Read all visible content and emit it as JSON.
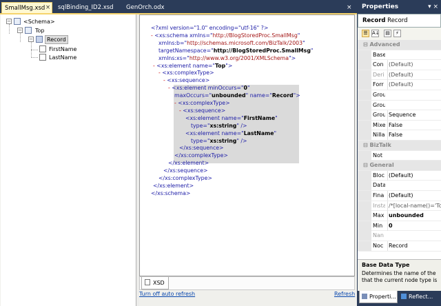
{
  "doc_tabs": [
    {
      "label": "SmallMsg.xsd",
      "active": true
    },
    {
      "label": "sqlBinding_ID2.xsd",
      "active": false
    },
    {
      "label": "GenOrch.odx",
      "active": false
    }
  ],
  "tab_close_glyph": "×",
  "tree": {
    "schema": "<Schema>",
    "top": "Top",
    "record": "Record",
    "fields": [
      "FirstName",
      "LastName"
    ]
  },
  "xml_lines": [
    [
      {
        "t": "<?xml version=\"1.0\" encoding=\"utf-16\" ?>",
        "c": "blue"
      }
    ],
    [
      {
        "t": "- ",
        "c": "minus"
      },
      {
        "t": "<xs:schema xmlns=\"",
        "c": "blue"
      },
      {
        "t": "http://BlogStoredProc.SmallMsg",
        "c": "red"
      },
      {
        "t": "\"",
        "c": "blue"
      }
    ],
    [
      {
        "t": "xmlns:b=\"",
        "c": "blue"
      },
      {
        "t": "http://schemas.microsoft.com/BizTalk/2003",
        "c": "red"
      },
      {
        "t": "\"",
        "c": "blue"
      }
    ],
    [
      {
        "t": "targetNamespace=\"",
        "c": "blue"
      },
      {
        "t": "http://BlogStoredProc.SmallMsg",
        "c": "black"
      },
      {
        "t": "\"",
        "c": "blue"
      }
    ],
    [
      {
        "t": "xmlns:xs=\"",
        "c": "blue"
      },
      {
        "t": "http://www.w3.org/2001/XMLSchema",
        "c": "red"
      },
      {
        "t": "\">",
        "c": "blue"
      }
    ],
    [
      {
        "t": "- ",
        "c": "minus"
      },
      {
        "t": "<xs:element name=\"",
        "c": "blue"
      },
      {
        "t": "Top",
        "c": "black"
      },
      {
        "t": "\">",
        "c": "blue"
      }
    ],
    [
      {
        "t": "- ",
        "c": "minus"
      },
      {
        "t": "<xs:complexType>",
        "c": "blue"
      }
    ],
    [
      {
        "t": "- ",
        "c": "minus"
      },
      {
        "t": "<xs:sequence>",
        "c": "blue"
      }
    ],
    [
      {
        "t": "- ",
        "c": "minus"
      },
      {
        "t": "<xs:element minOccurs=\"",
        "c": "blue"
      },
      {
        "t": "0",
        "c": "black"
      },
      {
        "t": "\"",
        "c": "blue"
      }
    ],
    [
      {
        "t": "maxOccurs=\"",
        "c": "blue"
      },
      {
        "t": "unbounded",
        "c": "black"
      },
      {
        "t": "\" name=\"",
        "c": "blue"
      },
      {
        "t": "Record",
        "c": "black"
      },
      {
        "t": "\">",
        "c": "blue"
      }
    ],
    [
      {
        "t": "- ",
        "c": "minus"
      },
      {
        "t": "<xs:complexType>",
        "c": "blue"
      }
    ],
    [
      {
        "t": "- ",
        "c": "minus"
      },
      {
        "t": "<xs:sequence>",
        "c": "blue"
      }
    ],
    [
      {
        "t": "<xs:element name=\"",
        "c": "blue"
      },
      {
        "t": "FirstName",
        "c": "black"
      },
      {
        "t": "\"",
        "c": "blue"
      }
    ],
    [
      {
        "t": "type=\"",
        "c": "blue"
      },
      {
        "t": "xs:string",
        "c": "black"
      },
      {
        "t": "\" />",
        "c": "blue"
      }
    ],
    [
      {
        "t": "<xs:element name=\"",
        "c": "blue"
      },
      {
        "t": "LastName",
        "c": "black"
      },
      {
        "t": "\"",
        "c": "blue"
      }
    ],
    [
      {
        "t": "type=\"",
        "c": "blue"
      },
      {
        "t": "xs:string",
        "c": "black"
      },
      {
        "t": "\" />",
        "c": "blue"
      }
    ],
    [
      {
        "t": "</xs:sequence>",
        "c": "blue"
      }
    ],
    [
      {
        "t": "</xs:complexType>",
        "c": "blue"
      }
    ],
    [
      {
        "t": "</xs:element>",
        "c": "blue"
      }
    ],
    [
      {
        "t": "</xs:sequence>",
        "c": "blue"
      }
    ],
    [
      {
        "t": "</xs:complexType>",
        "c": "blue"
      }
    ],
    [
      {
        "t": "</xs:element>",
        "c": "blue"
      }
    ],
    [
      {
        "t": "</xs:schema>",
        "c": "blue"
      }
    ]
  ],
  "xsd_tab_label": "XSD",
  "links": {
    "auto_refresh": "Turn off auto refresh",
    "refresh": "Refresh"
  },
  "properties": {
    "title": "Properties",
    "pin_glyph": "▾ ×",
    "object_name": "Record",
    "object_type": "Record",
    "toolbar": [
      "☰",
      "A↓",
      "▤",
      "⚡"
    ],
    "rows": [
      {
        "cat": true,
        "name": "Advanced"
      },
      {
        "name": "Base",
        "value": "",
        "dim": false
      },
      {
        "name": "Con",
        "value": "(Default)",
        "dim": true
      },
      {
        "name": "Deri",
        "value": "(Default)",
        "dim": true,
        "gray": true
      },
      {
        "name": "Forr",
        "value": "(Default)",
        "dim": true
      },
      {
        "name": "Grou",
        "value": "",
        "dim": false
      },
      {
        "name": "Grou",
        "value": "",
        "dim": false
      },
      {
        "name": "Grou",
        "value": "Sequence",
        "dim": false
      },
      {
        "name": "Mixe",
        "value": "False",
        "dim": false
      },
      {
        "name": "Nilla",
        "value": "False",
        "dim": false
      },
      {
        "cat": true,
        "name": "BizTalk"
      },
      {
        "name": "Not",
        "value": "",
        "dim": false
      },
      {
        "cat": true,
        "name": "General"
      },
      {
        "name": "Bloc",
        "value": "(Default)",
        "dim": false
      },
      {
        "name": "Data",
        "value": "",
        "dim": false
      },
      {
        "name": "Fina",
        "value": "(Default)",
        "dim": false
      },
      {
        "name": "Insta",
        "value": "/*[local-name()='To",
        "dim": true,
        "gray": true
      },
      {
        "name": "Max",
        "value": "unbounded",
        "bold": true
      },
      {
        "name": "Min",
        "value": "0",
        "bold": true
      },
      {
        "name": "Nan",
        "value": "",
        "dim": false,
        "gray": true
      },
      {
        "name": "Noc",
        "value": "Record",
        "dim": false
      }
    ],
    "description_title": "Base Data Type",
    "description_lines": [
      "Determines the name of the",
      "that the current node type is"
    ],
    "bottom_tabs": [
      "Properti...",
      "Reflect..."
    ]
  }
}
